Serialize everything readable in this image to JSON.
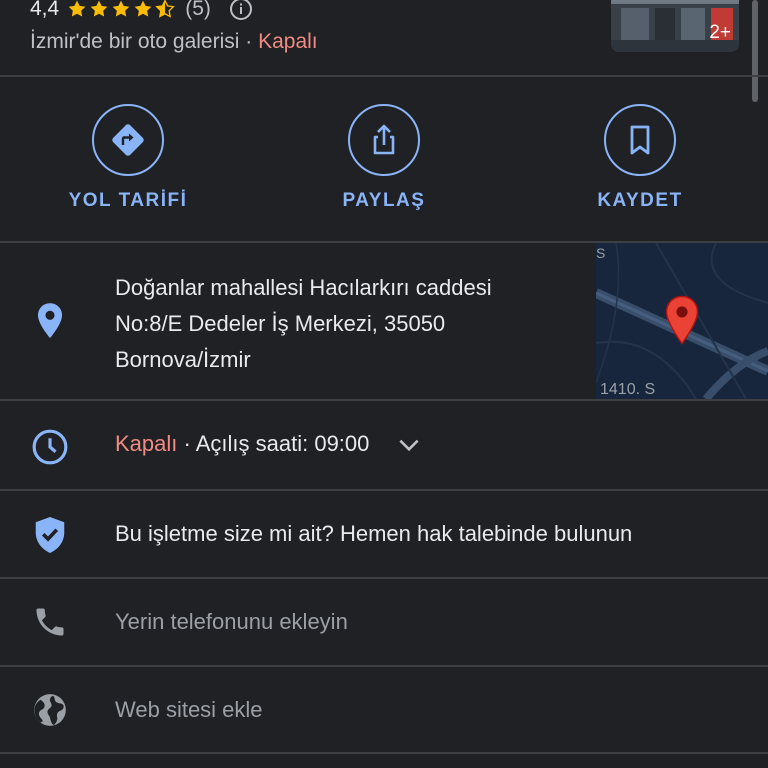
{
  "place": {
    "rating": "4,4",
    "stars": 4.5,
    "review_count": "(5)",
    "category": "İzmir'de bir oto galerisi",
    "separator": " · ",
    "status": "Kapalı",
    "photo_count": "2+"
  },
  "actions": [
    {
      "label": "YOL TARİFİ",
      "icon": "directions-icon"
    },
    {
      "label": "PAYLAŞ",
      "icon": "share-icon"
    },
    {
      "label": "KAYDET",
      "icon": "bookmark-icon"
    }
  ],
  "address": {
    "lines": [
      "Doğanlar mahallesi Hacılarkırı caddesi",
      "No:8/E Dedeler İş Merkezi, 35050",
      "Bornova/İzmir"
    ],
    "map_road_label": "1410. S",
    "map_edge_label": "S"
  },
  "hours": {
    "status": "Kapalı",
    "separator": " · ",
    "opening": "Açılış saati: 09:00"
  },
  "claim": {
    "text": "Bu işletme size mi ait? Hemen hak talebinde bulunun"
  },
  "phone": {
    "text": "Yerin telefonunu ekleyin"
  },
  "website": {
    "text": "Web sitesi ekle"
  },
  "colors": {
    "background": "#202124",
    "accent": "#8ab4f8",
    "closed": "#f28b82",
    "divider": "#3c4043",
    "pin": "#ea4335"
  }
}
